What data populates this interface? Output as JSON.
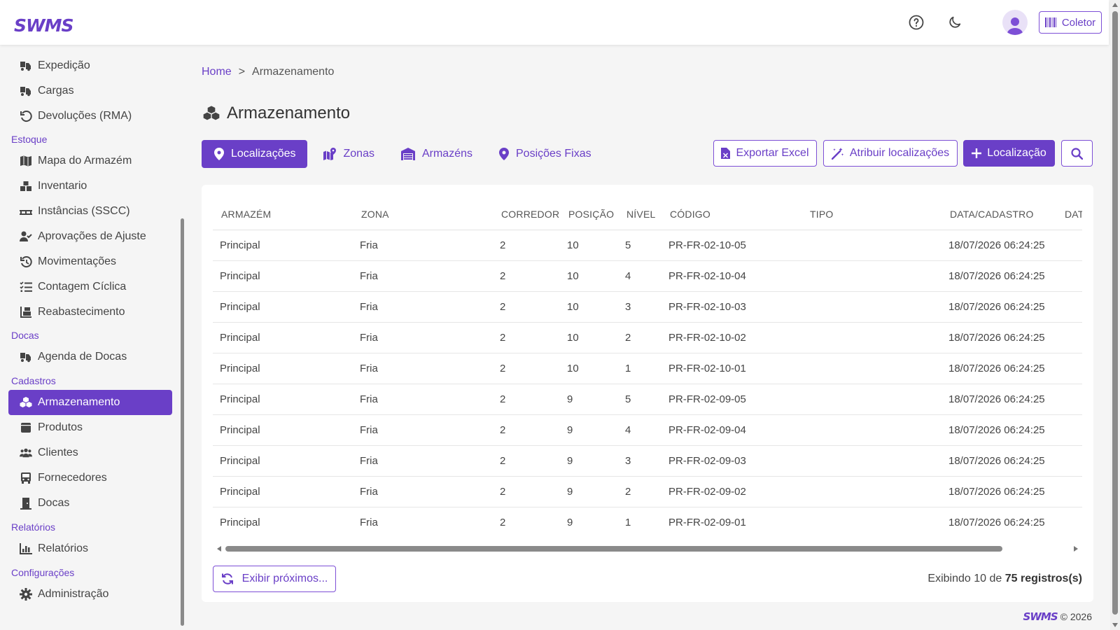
{
  "header": {
    "logo": "SWMS",
    "coletor_label": "Coletor",
    "icons": [
      "help-circle-icon",
      "moon-icon",
      "user-avatar-icon",
      "barcode-icon"
    ]
  },
  "colors": {
    "accent": "#6a3fc7",
    "text": "#444444",
    "background": "#f5f5f5"
  },
  "sidebar": {
    "items": [
      {
        "label": "Expedição",
        "icon": "truck-loading-icon"
      },
      {
        "label": "Cargas",
        "icon": "truck-loading-icon"
      },
      {
        "label": "Devoluções (RMA)",
        "icon": "undo-icon"
      },
      {
        "label": "Mapa do Armazém",
        "icon": "map-icon"
      },
      {
        "label": "Inventario",
        "icon": "boxes-icon"
      },
      {
        "label": "Instâncias (SSCC)",
        "icon": "pallet-icon"
      },
      {
        "label": "Aprovações de Ajuste",
        "icon": "user-check-icon"
      },
      {
        "label": "Movimentações",
        "icon": "history-icon"
      },
      {
        "label": "Contagem Cíclica",
        "icon": "list-check-icon"
      },
      {
        "label": "Reabastecimento",
        "icon": "dolly-icon"
      },
      {
        "label": "Agenda de Docas",
        "icon": "truck-loading-icon"
      },
      {
        "label": "Armazenamento",
        "icon": "cubes-icon"
      },
      {
        "label": "Produtos",
        "icon": "box-icon"
      },
      {
        "label": "Clientes",
        "icon": "users-icon"
      },
      {
        "label": "Fornecedores",
        "icon": "bus-icon"
      },
      {
        "label": "Docas",
        "icon": "door-icon"
      },
      {
        "label": "Relatórios",
        "icon": "chart-icon"
      },
      {
        "label": "Administração",
        "icon": "gear-icon"
      }
    ],
    "sections": {
      "estoque": "Estoque",
      "docas": "Docas",
      "cadastros": "Cadastros",
      "relatorios": "Relatórios",
      "configuracoes": "Configurações"
    }
  },
  "breadcrumb": {
    "home": "Home",
    "separator": ">",
    "current": "Armazenamento"
  },
  "page": {
    "title": "Armazenamento"
  },
  "tabs": [
    {
      "label": "Localizações",
      "icon": "map-pin-icon"
    },
    {
      "label": "Zonas",
      "icon": "map-marked-icon"
    },
    {
      "label": "Armazéns",
      "icon": "warehouse-icon"
    },
    {
      "label": "Posições Fixas",
      "icon": "map-pin-icon"
    }
  ],
  "actions": {
    "export": "Exportar Excel",
    "assign": "Atribuir localizações",
    "add": "Localização"
  },
  "table": {
    "columns": [
      "ARMAZÉM",
      "ZONA",
      "CORREDOR",
      "POSIÇÃO",
      "NÍVEL",
      "CÓDIGO",
      "TIPO",
      "DATA/CADASTRO",
      "DAT"
    ],
    "rows": [
      [
        "Principal",
        "Fria",
        "2",
        "10",
        "5",
        "PR-FR-02-10-05",
        "",
        "18/07/2026 06:24:25"
      ],
      [
        "Principal",
        "Fria",
        "2",
        "10",
        "4",
        "PR-FR-02-10-04",
        "",
        "18/07/2026 06:24:25"
      ],
      [
        "Principal",
        "Fria",
        "2",
        "10",
        "3",
        "PR-FR-02-10-03",
        "",
        "18/07/2026 06:24:25"
      ],
      [
        "Principal",
        "Fria",
        "2",
        "10",
        "2",
        "PR-FR-02-10-02",
        "",
        "18/07/2026 06:24:25"
      ],
      [
        "Principal",
        "Fria",
        "2",
        "10",
        "1",
        "PR-FR-02-10-01",
        "",
        "18/07/2026 06:24:25"
      ],
      [
        "Principal",
        "Fria",
        "2",
        "9",
        "5",
        "PR-FR-02-09-05",
        "",
        "18/07/2026 06:24:25"
      ],
      [
        "Principal",
        "Fria",
        "2",
        "9",
        "4",
        "PR-FR-02-09-04",
        "",
        "18/07/2026 06:24:25"
      ],
      [
        "Principal",
        "Fria",
        "2",
        "9",
        "3",
        "PR-FR-02-09-03",
        "",
        "18/07/2026 06:24:25"
      ],
      [
        "Principal",
        "Fria",
        "2",
        "9",
        "2",
        "PR-FR-02-09-02",
        "",
        "18/07/2026 06:24:25"
      ],
      [
        "Principal",
        "Fria",
        "2",
        "9",
        "1",
        "PR-FR-02-09-01",
        "",
        "18/07/2026 06:24:25"
      ]
    ]
  },
  "pagination": {
    "more_label": "Exibir próximos...",
    "records_prefix": "Exibindo 10 de",
    "records_bold": "75 registros(s)"
  },
  "footer": {
    "logo": "SWMS",
    "copyright": "© 2026"
  }
}
